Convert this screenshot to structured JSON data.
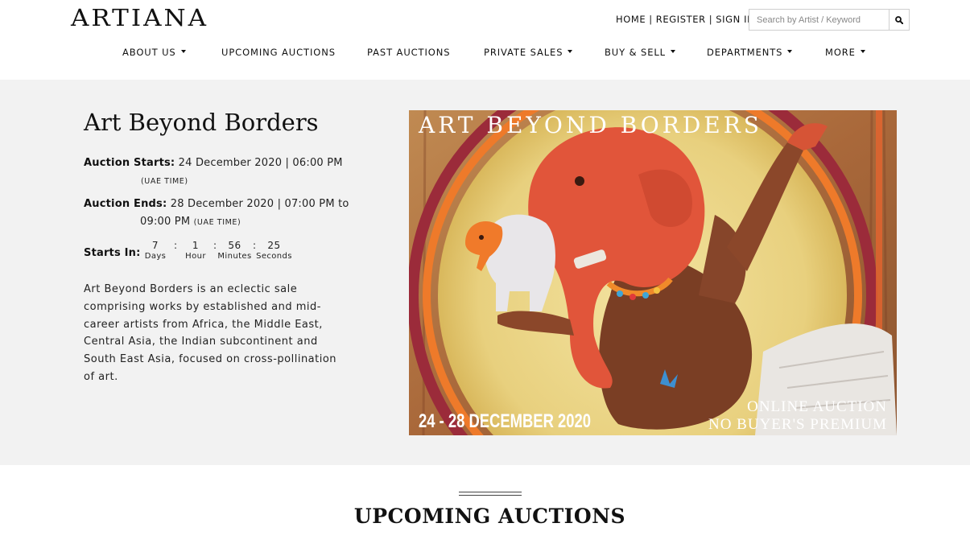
{
  "brand": {
    "logo": "ARTIANA"
  },
  "toplinks": {
    "home": "HOME",
    "register": "REGISTER",
    "signin": "SIGN IN",
    "separator": "|"
  },
  "search": {
    "placeholder": "Search by Artist / Keyword",
    "icon": "search-icon"
  },
  "nav": [
    {
      "label": "ABOUT US",
      "dropdown": true
    },
    {
      "label": "UPCOMING AUCTIONS",
      "dropdown": false
    },
    {
      "label": "PAST AUCTIONS",
      "dropdown": false
    },
    {
      "label": "PRIVATE SALES",
      "dropdown": true
    },
    {
      "label": "BUY & SELL",
      "dropdown": true
    },
    {
      "label": "DEPARTMENTS",
      "dropdown": true
    },
    {
      "label": "MORE",
      "dropdown": true
    }
  ],
  "auction": {
    "title": "Art Beyond Borders",
    "starts_label": "Auction Starts:",
    "starts_value": "24 December 2020 | 06:00 PM",
    "starts_tz": "(UAE TIME)",
    "ends_label": "Auction Ends:",
    "ends_value_line1": "28 December 2020 | 07:00 PM to",
    "ends_value_line2": "09:00 PM",
    "ends_tz": "(UAE TIME)",
    "countdown_label": "Starts In:",
    "countdown": [
      {
        "value": "7",
        "unit": "Days"
      },
      {
        "value": "1",
        "unit": "Hour"
      },
      {
        "value": "56",
        "unit": "Minutes"
      },
      {
        "value": "25",
        "unit": "Seconds"
      }
    ],
    "countdown_separator": ":",
    "description": "Art Beyond Borders is an eclectic sale comprising works by established and mid-career artists from Africa, the Middle East, Central Asia, the Indian subcontinent and South East Asia, focused on cross-pollination of art."
  },
  "banner": {
    "heading": "ART BEYOND BORDERS",
    "dates": "24 - 28 DECEMBER 2020",
    "line1": "ONLINE AUCTION",
    "line2": "NO BUYER'S PREMIUM"
  },
  "sections": {
    "upcoming_title": "UPCOMING AUCTIONS"
  },
  "colors": {
    "hero_bg": "#f2f2f2",
    "banner_bg": "#b3743f",
    "elephant": "#e0553a",
    "halo": "#ecd98a"
  }
}
